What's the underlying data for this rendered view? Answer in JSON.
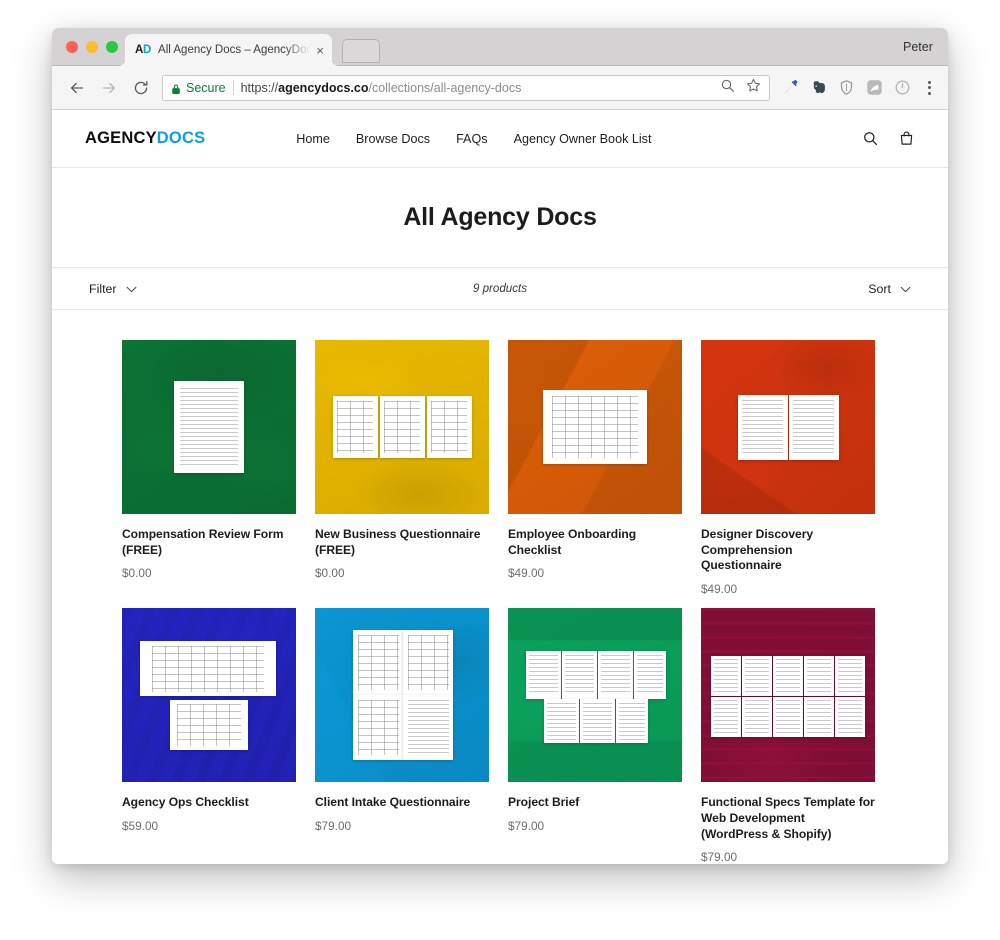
{
  "browser": {
    "tab": {
      "favicon_a": "A",
      "favicon_d": "D",
      "title": "All Agency Docs – AgencyDocs",
      "close_label": "×"
    },
    "omnibox": {
      "secure_label": "Secure",
      "url_scheme": "https://",
      "url_host": "agencydocs.co",
      "url_path": "/collections/all-agency-docs"
    },
    "profile_name": "Peter",
    "icons": {
      "back": "back-arrow-icon",
      "forward": "forward-arrow-icon",
      "reload": "reload-icon",
      "lock": "lock-icon",
      "page_search": "magnifier-icon",
      "bookmark": "star-icon",
      "eyedropper": "eyedropper-icon",
      "evernote": "elephant-icon",
      "shield": "shield-icon",
      "square_extension": "rounded-square-icon",
      "timer": "clock-icon",
      "menu": "kebab-menu-icon"
    }
  },
  "site": {
    "logo": {
      "part1": "AGENCY",
      "part2": "DOCS"
    },
    "nav": [
      {
        "label": "Home"
      },
      {
        "label": "Browse Docs"
      },
      {
        "label": "FAQs"
      },
      {
        "label": "Agency Owner Book List"
      }
    ],
    "header_actions": {
      "search": "search-icon",
      "cart": "shopping-bag-icon"
    }
  },
  "collection": {
    "title": "All Agency Docs",
    "filter_label": "Filter",
    "sort_label": "Sort",
    "product_count": "9 products"
  },
  "products": [
    {
      "title": "Compensation Review Form (FREE)",
      "price": "$0.00",
      "color": "#0b7a38",
      "layout": "single-portrait"
    },
    {
      "title": "New Business Questionnaire (FREE)",
      "price": "$0.00",
      "color": "#f2c200",
      "layout": "three-across"
    },
    {
      "title": "Employee Onboarding Checklist",
      "price": "$49.00",
      "color": "#ec6608",
      "layout": "landscape-table"
    },
    {
      "title": "Designer Discovery Comprehension Questionnaire",
      "price": "$49.00",
      "color": "#e0380f",
      "layout": "two-page-spread"
    },
    {
      "title": "Agency Ops Checklist",
      "price": "$59.00",
      "color": "#2626cc",
      "layout": "spread-plus-sheet"
    },
    {
      "title": "Client Intake Questionnaire",
      "price": "$79.00",
      "color": "#0b9cd8",
      "layout": "quad-grid"
    },
    {
      "title": "Project Brief",
      "price": "$79.00",
      "color": "#0bac63",
      "layout": "seven-pages"
    },
    {
      "title": "Functional Specs Template for Web Development (WordPress & Shopify)",
      "price": "$79.00",
      "color": "#b0144a",
      "layout": "ten-page-grid"
    }
  ]
}
